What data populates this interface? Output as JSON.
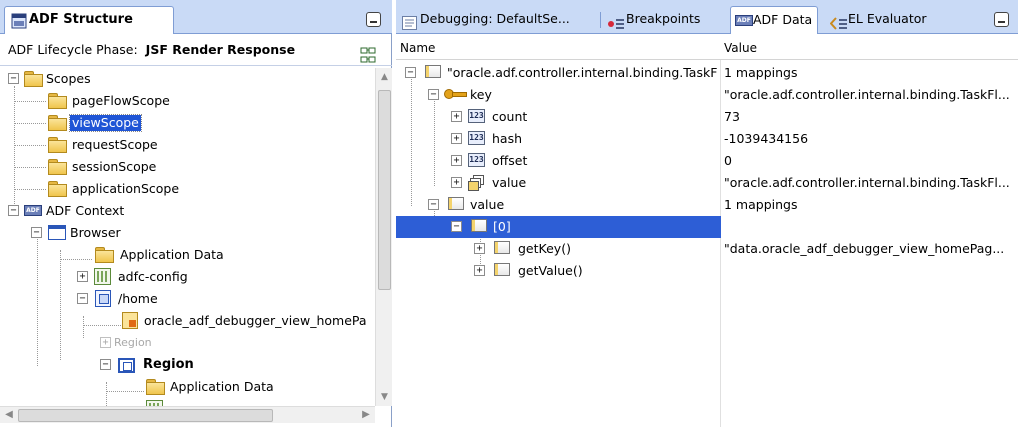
{
  "left": {
    "tab_title": "ADF Structure",
    "phase_label": "ADF Lifecycle Phase:",
    "phase_value": "JSF Render Response",
    "tree": [
      {
        "label": "Scopes",
        "icon": "folder-icon",
        "expander": "−"
      },
      {
        "label": "pageFlowScope",
        "icon": "folder-icon"
      },
      {
        "label": "viewScope",
        "icon": "folder-icon",
        "selected": true
      },
      {
        "label": "requestScope",
        "icon": "folder-icon"
      },
      {
        "label": "sessionScope",
        "icon": "folder-icon"
      },
      {
        "label": "applicationScope",
        "icon": "folder-icon"
      },
      {
        "label": "ADF Context",
        "icon": "adf-icon",
        "expander": "−"
      },
      {
        "label": "Browser",
        "icon": "browser-icon",
        "expander": "−"
      },
      {
        "label": "Application Data",
        "icon": "folder-icon"
      },
      {
        "label": "adfc-config",
        "icon": "config-icon",
        "expander": "+"
      },
      {
        "label": "/home",
        "icon": "page-icon",
        "expander": "−"
      },
      {
        "label": "oracle_adf_debugger_view_homePa",
        "icon": "jsf-page-icon"
      },
      {
        "label": "Region",
        "icon": "region-icon",
        "expander": "+",
        "disabled": true
      },
      {
        "label": "Region",
        "icon": "region-icon",
        "expander": "−",
        "bold": true
      },
      {
        "label": "Application Data",
        "icon": "folder-icon"
      }
    ]
  },
  "right": {
    "tabs": [
      {
        "label": "Debugging: DefaultSe...",
        "icon": "debug-console-icon"
      },
      {
        "label": "Breakpoints",
        "icon": "breakpoints-icon"
      },
      {
        "label": "ADF Data",
        "icon": "adf-icon",
        "active": true
      },
      {
        "label": "EL Evaluator",
        "icon": "el-evaluator-icon"
      }
    ],
    "columns": {
      "name": "Name",
      "value": "Value"
    },
    "rows": [
      {
        "name": "\"oracle.adf.controller.internal.binding.TaskF",
        "value": "1 mappings",
        "expander": "−",
        "icon": "object-icon"
      },
      {
        "name": "key",
        "value": "\"oracle.adf.controller.internal.binding.TaskFl...",
        "expander": "−",
        "icon": "key-icon"
      },
      {
        "name": "count",
        "value": "73",
        "expander": "+",
        "icon": "number-icon"
      },
      {
        "name": "hash",
        "value": "-1039434156",
        "expander": "+",
        "icon": "number-icon"
      },
      {
        "name": "offset",
        "value": "0",
        "expander": "+",
        "icon": "number-icon"
      },
      {
        "name": "value",
        "value": "\"oracle.adf.controller.internal.binding.TaskFl...",
        "expander": "+",
        "icon": "collection-icon"
      },
      {
        "name": "value",
        "value": "1 mappings",
        "expander": "−",
        "icon": "object-icon"
      },
      {
        "name": "[0]",
        "value": "",
        "expander": "−",
        "icon": "object-icon",
        "selected": true
      },
      {
        "name": "getKey()",
        "value": "\"data.oracle_adf_debugger_view_homePag...",
        "expander": "+",
        "icon": "object-icon"
      },
      {
        "name": "getValue()",
        "value": "",
        "expander": "+",
        "icon": "object-icon"
      }
    ]
  },
  "icons": {
    "number_icon_text": "123",
    "adf_icon_text": "ADF"
  },
  "colors": {
    "tabbar_bg": "#c9daf6",
    "selection": "#2d5ed6",
    "folder": "#f0c54c"
  }
}
